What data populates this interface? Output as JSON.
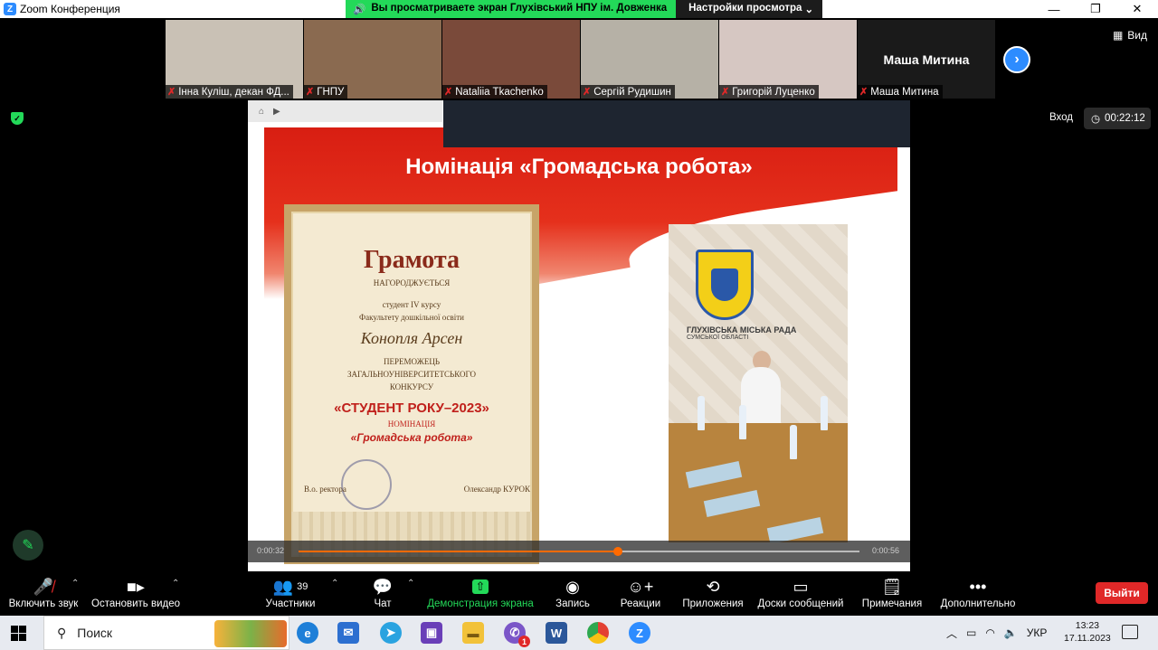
{
  "window": {
    "title": "Zoom Конференция"
  },
  "share_banner": {
    "message": "Вы просматриваете экран Глухівський НПУ ім. Довженка",
    "options_label": "Настройки просмотра"
  },
  "view_label": "Вид",
  "participants_strip": [
    {
      "name": "Інна Куліш, декан ФД...",
      "bg": "#c9c1b5"
    },
    {
      "name": "ГНПУ",
      "bg": "#8a6a50"
    },
    {
      "name": "Nataliia Tkachenko",
      "bg": "#7a4a3a"
    },
    {
      "name": "Сергій Рудишин",
      "bg": "#b6b1a6"
    },
    {
      "name": "Григорій Луценко",
      "bg": "#d6c7c2"
    },
    {
      "name": "Маша Митина",
      "bg": "#1a1a1a",
      "display": "Маша Митина"
    }
  ],
  "status": {
    "login_label": "Вход",
    "elapsed": "00:22:12"
  },
  "slide": {
    "title": "Номінація «Громадська робота»",
    "diploma": {
      "heading": "Грамота",
      "line1": "НАГОРОДЖУЄТЬСЯ",
      "line2": "студент IV курсу",
      "line3": "Факультету дошкільної освіти",
      "name": "Конопля Арсен",
      "line4": "ПЕРЕМОЖЕЦЬ",
      "line5": "ЗАГАЛЬНОУНІВЕРСИТЕТСЬКОГО",
      "line6": "КОНКУРСУ",
      "contest": "«СТУДЕНТ РОКУ–2023»",
      "line7": "НОМІНАЦІЯ",
      "nomination": "«Громадська робота»",
      "sign_left": "В.о. ректора",
      "sign_right": "Олександр КУРОК"
    },
    "photo_caption": "ГЛУХІВСЬКА МІСЬКА РАДА",
    "photo_caption2": "СУМСЬКОЇ ОБЛАСТІ"
  },
  "video": {
    "elapsed": "0:00:32",
    "total": "0:00:56",
    "progress": 0.57
  },
  "toolbar": {
    "mute": "Включить звук",
    "video": "Остановить видео",
    "participants": "Участники",
    "participants_count": "39",
    "chat": "Чат",
    "share": "Демонстрация экрана",
    "record": "Запись",
    "reactions": "Реакции",
    "apps": "Приложения",
    "whiteboards": "Доски сообщений",
    "notes": "Примечания",
    "more": "Дополнительно",
    "leave": "Выйти"
  },
  "taskbar": {
    "search_placeholder": "Поиск",
    "viber_badge": "1",
    "lang": "УКР",
    "time": "13:23",
    "date": "17.11.2023"
  },
  "colors": {
    "zoom_blue": "#2d8cff",
    "share_green": "#23d959",
    "leave_red": "#e02828"
  }
}
